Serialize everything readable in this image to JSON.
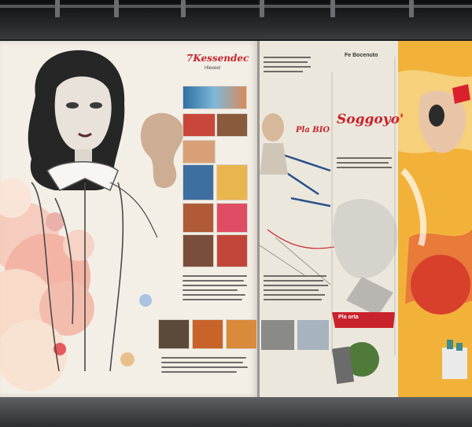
{
  "scene": {
    "colors": {
      "wall": "#1b1d1f",
      "panel": "#f3efe6",
      "accent_red": "#c8232c",
      "accent_yellow": "#f2b23a",
      "accent_blue": "#2a4f8a"
    },
    "left_panel": {
      "headline": "7Kessendec",
      "subhead": "Hlexeel"
    },
    "right_panel": {
      "headline": "Pla orta",
      "big_title": "Soggoyo'",
      "top_label": "Fe Bocenuto",
      "mid_label": "Pla BIO"
    }
  }
}
